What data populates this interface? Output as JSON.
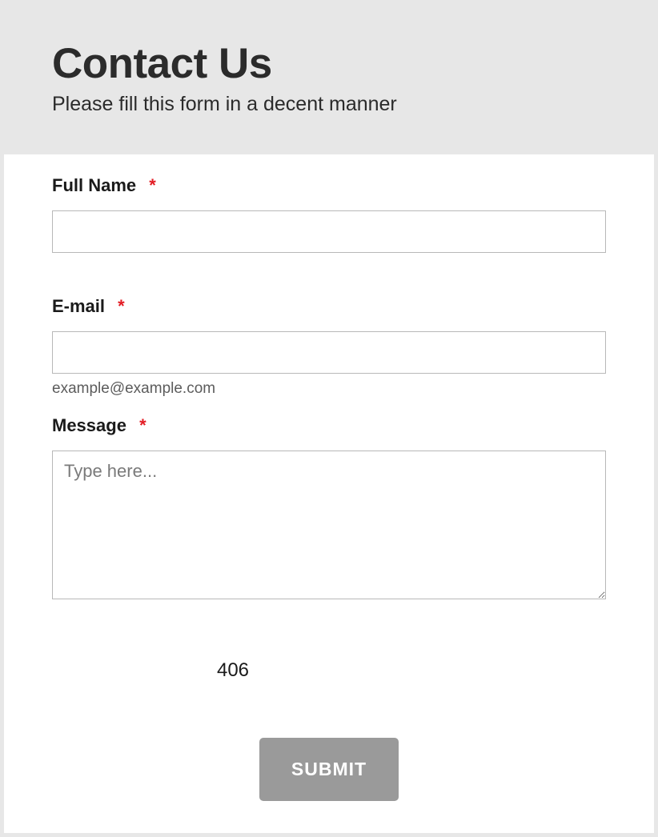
{
  "header": {
    "title": "Contact Us",
    "subtitle": "Please fill this form in a decent manner"
  },
  "form": {
    "fullName": {
      "label": "Full Name",
      "required": "*",
      "value": ""
    },
    "email": {
      "label": "E-mail",
      "required": "*",
      "value": "",
      "hint": "example@example.com"
    },
    "message": {
      "label": "Message",
      "required": "*",
      "placeholder": "Type here...",
      "value": ""
    },
    "captcha": "406",
    "submit": "SUBMIT"
  }
}
